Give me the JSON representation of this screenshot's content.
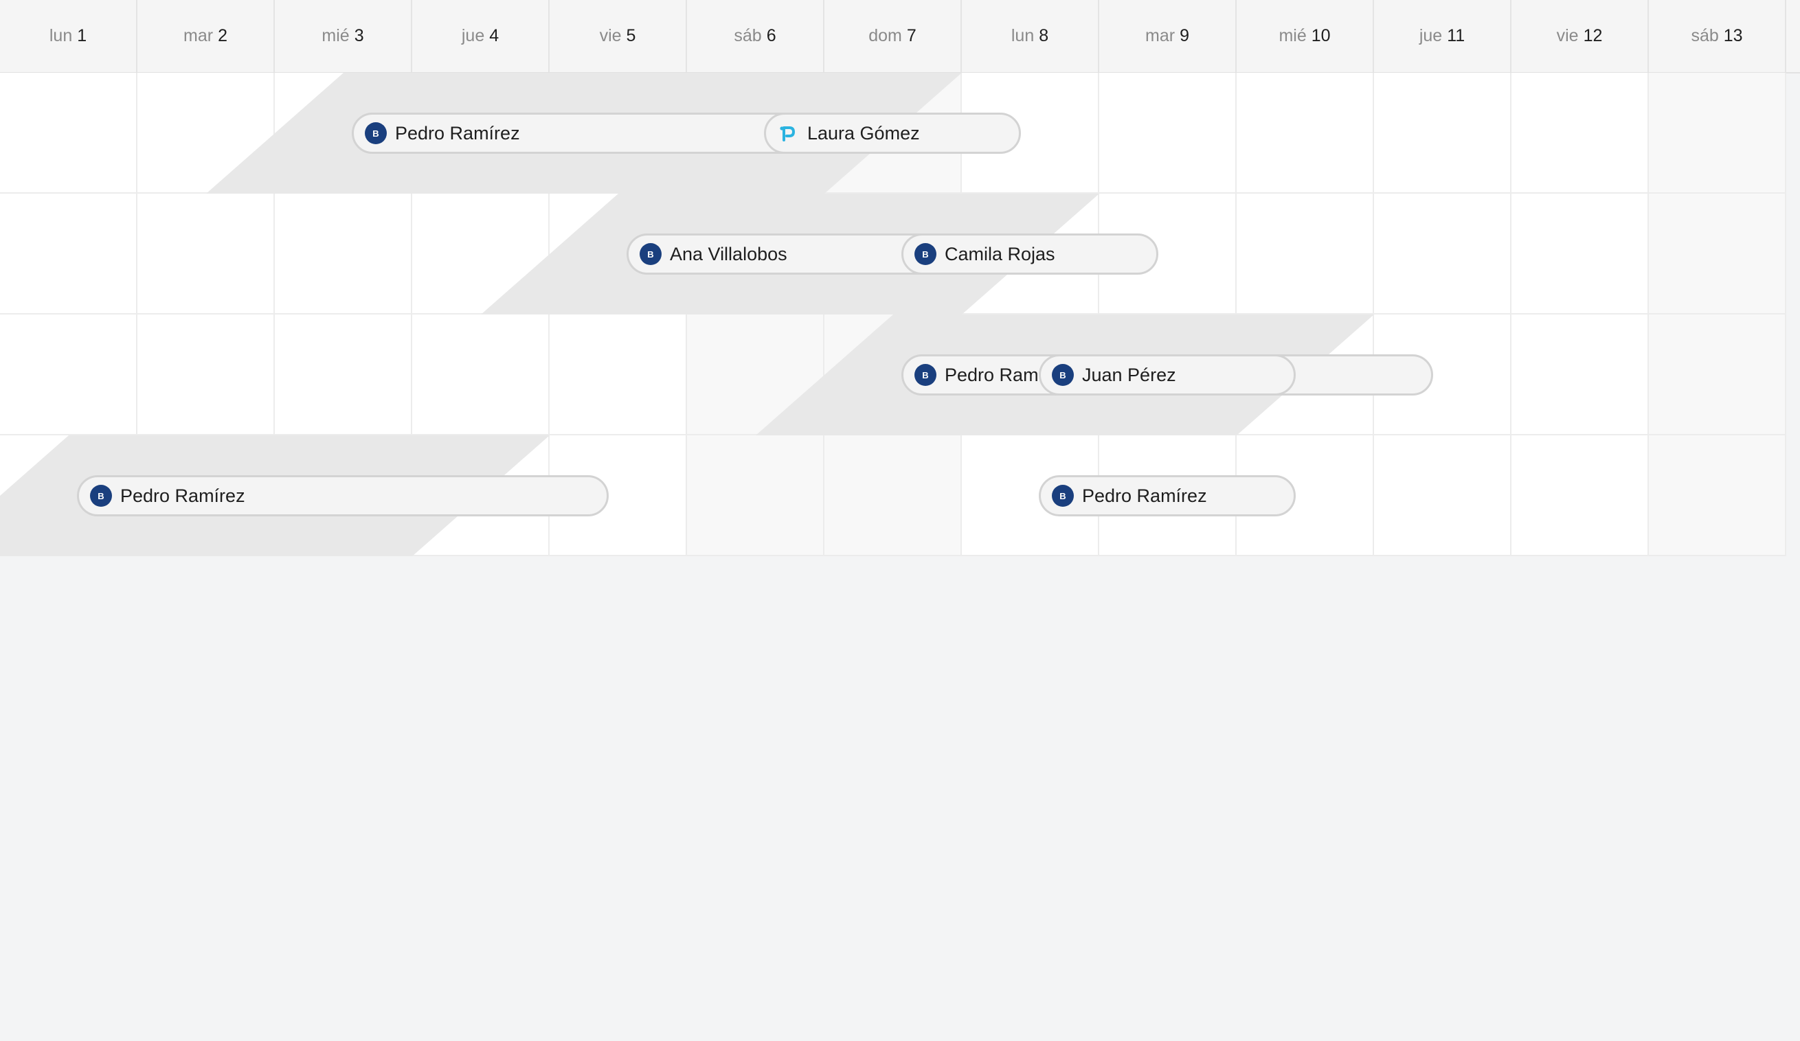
{
  "days": [
    {
      "name": "lun",
      "num": "1",
      "weekend": false
    },
    {
      "name": "mar",
      "num": "2",
      "weekend": false
    },
    {
      "name": "mié",
      "num": "3",
      "weekend": false
    },
    {
      "name": "jue",
      "num": "4",
      "weekend": false
    },
    {
      "name": "vie",
      "num": "5",
      "weekend": false
    },
    {
      "name": "sáb",
      "num": "6",
      "weekend": true
    },
    {
      "name": "dom",
      "num": "7",
      "weekend": true
    },
    {
      "name": "lun",
      "num": "8",
      "weekend": false
    },
    {
      "name": "mar",
      "num": "9",
      "weekend": false
    },
    {
      "name": "mié",
      "num": "10",
      "weekend": false
    },
    {
      "name": "jue",
      "num": "11",
      "weekend": false
    },
    {
      "name": "vie",
      "num": "12",
      "weekend": false
    },
    {
      "name": "sáb",
      "num": "13",
      "weekend": true
    }
  ],
  "rows": [
    {
      "band": {
        "from_day": 3,
        "to_day": 7
      },
      "bookings": [
        {
          "guest": "Pedro Ramírez",
          "source": "booking",
          "icon": "booking-icon",
          "badge": "B"
        },
        {
          "guest": "Laura Gómez",
          "source": "direct",
          "icon": "direct-booking-icon",
          "badge": ""
        }
      ]
    },
    {
      "band": {
        "from_day": 5,
        "to_day": 8
      },
      "bookings": [
        {
          "guest": "Ana Villalobos",
          "source": "booking",
          "icon": "booking-icon",
          "badge": "B"
        },
        {
          "guest": "Camila Rojas",
          "source": "booking",
          "icon": "booking-icon",
          "badge": "B"
        }
      ]
    },
    {
      "band": {
        "from_day": 7,
        "to_day": 10
      },
      "bookings": [
        {
          "guest": "Pedro Ramírez",
          "source": "booking",
          "icon": "booking-icon",
          "badge": "B"
        },
        {
          "guest": "Juan Pérez",
          "source": "booking",
          "icon": "booking-icon",
          "badge": "B"
        }
      ]
    },
    {
      "band": {
        "from_day": 1,
        "to_day": 4
      },
      "bookings": [
        {
          "guest": "Pedro Ramírez",
          "source": "booking",
          "icon": "booking-icon",
          "badge": "B"
        },
        {
          "guest": "Pedro Ramírez",
          "source": "booking",
          "icon": "booking-icon",
          "badge": "B"
        }
      ]
    }
  ],
  "colors": {
    "booking_badge": "#1a3f7e",
    "direct_badge": "#2bb3e0",
    "band": "#e8e8e8",
    "weekend_cell": "#f8f8f8",
    "page_background": "#f3f4f5"
  }
}
